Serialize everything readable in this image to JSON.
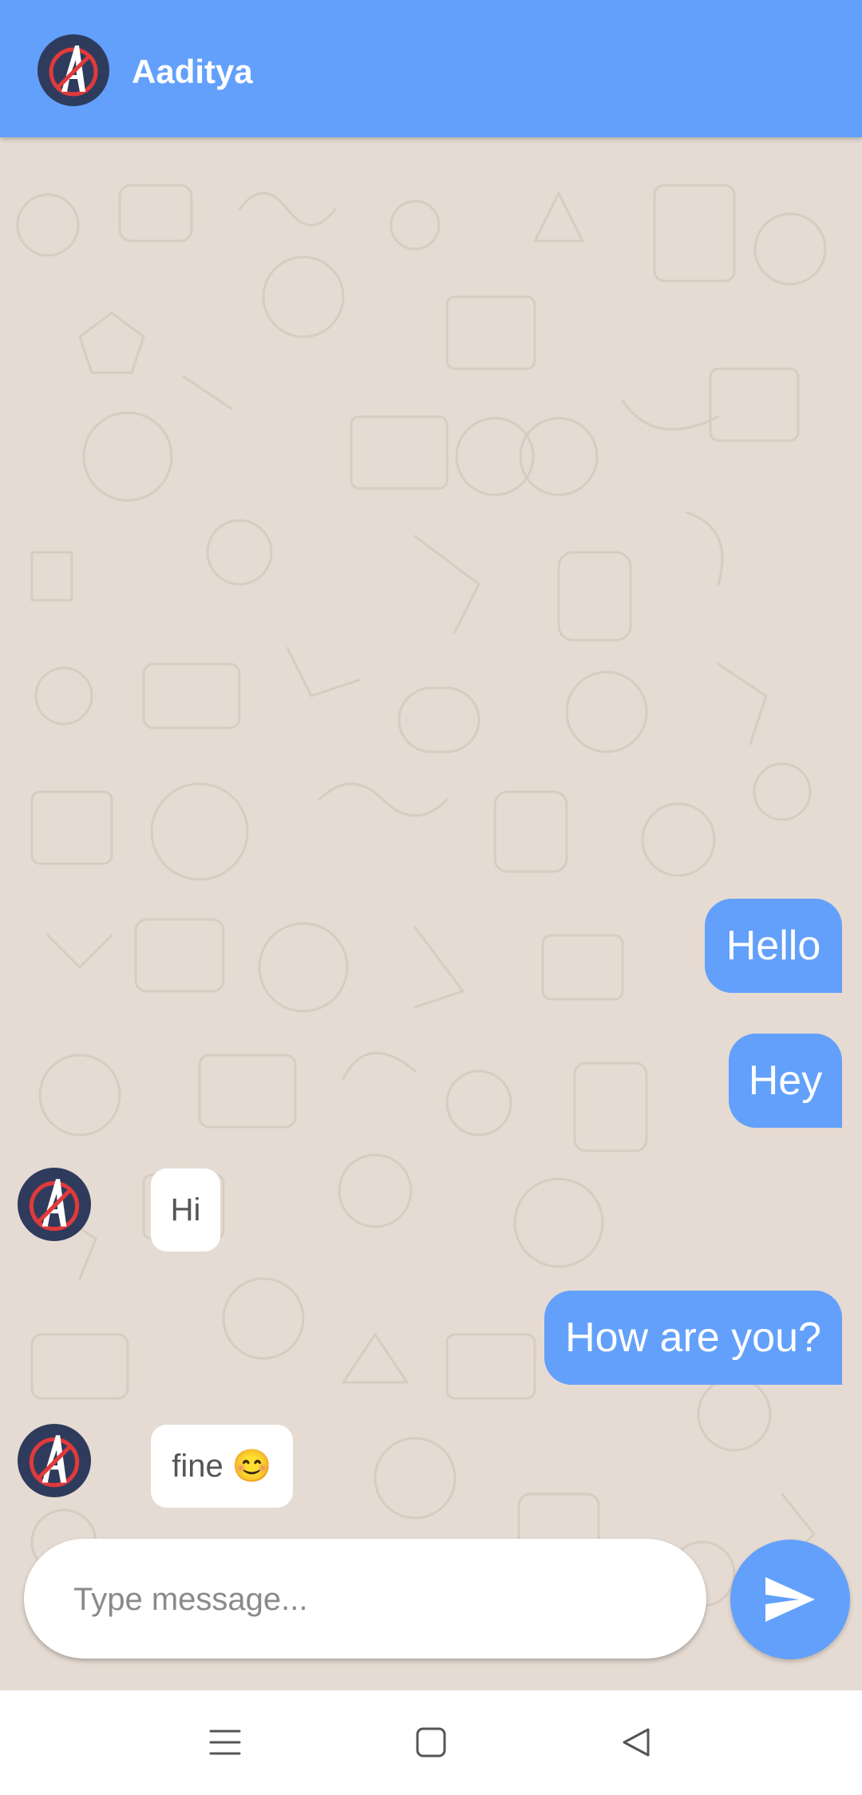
{
  "header": {
    "contact_name": "Aaditya",
    "avatar_icon": "avengers-logo-icon"
  },
  "colors": {
    "accent": "#62a0fb",
    "chat_background": "#e5dbd2",
    "received_bubble": "#ffffff",
    "nav_bar": "#ffffff"
  },
  "messages": [
    {
      "direction": "sent",
      "text": "Hello"
    },
    {
      "direction": "sent",
      "text": "Hey"
    },
    {
      "direction": "received",
      "text": "Hi"
    },
    {
      "direction": "sent",
      "text": "How are you?"
    },
    {
      "direction": "received",
      "text": "fine 😊"
    }
  ],
  "composer": {
    "placeholder": "Type message...",
    "value": "",
    "send_icon": "send-icon"
  },
  "navbar": {
    "icons": [
      "menu-icon",
      "home-square-icon",
      "back-triangle-icon"
    ]
  }
}
